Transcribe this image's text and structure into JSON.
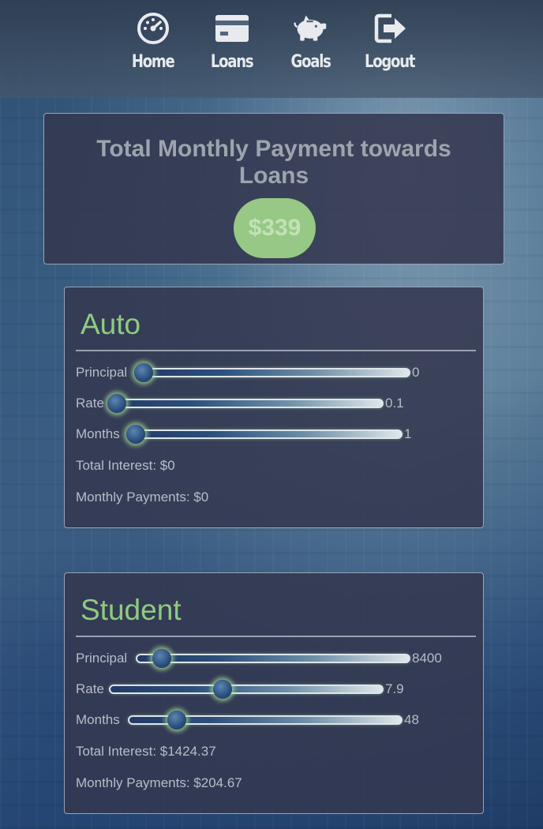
{
  "nav": {
    "items": [
      {
        "label": "Home",
        "icon": "dashboard-icon"
      },
      {
        "label": "Loans",
        "icon": "credit-card-icon"
      },
      {
        "label": "Goals",
        "icon": "piggy-bank-icon"
      },
      {
        "label": "Logout",
        "icon": "logout-icon"
      }
    ]
  },
  "total": {
    "title": "Total Monthly Payment towards Loans",
    "amount": "$339"
  },
  "colors": {
    "accent_green": "#97c886",
    "title_green": "#8fcb7f",
    "panel": "#343850"
  },
  "loans": {
    "auto": {
      "title": "Auto",
      "principal": {
        "label": "Principal",
        "value": "0",
        "fraction": 0.0
      },
      "rate": {
        "label": "Rate",
        "value": "0.1",
        "fraction": 0.0
      },
      "months": {
        "label": "Months",
        "value": "1",
        "fraction": 0.0
      },
      "total_interest": "Total Interest: $0",
      "monthly_payments": "Monthly Payments: $0"
    },
    "student": {
      "title": "Student",
      "principal": {
        "label": "Principal",
        "value": "8400",
        "fraction": 0.07
      },
      "rate": {
        "label": "Rate",
        "value": "7.9",
        "fraction": 0.41
      },
      "months": {
        "label": "Months",
        "value": "48",
        "fraction": 0.16
      },
      "total_interest": "Total Interest: $1424.37",
      "monthly_payments": "Monthly Payments: $204.67"
    }
  }
}
